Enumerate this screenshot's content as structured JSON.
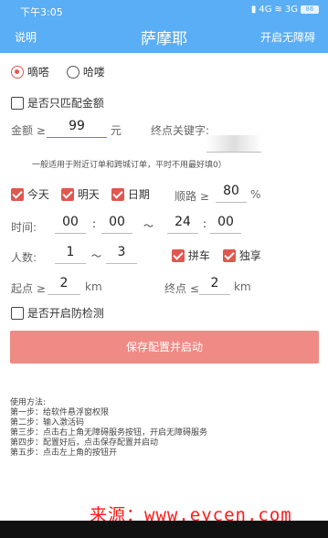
{
  "status": {
    "time": "下午3:05",
    "signal": "4G",
    "signal2": "3G",
    "battery": "86"
  },
  "appbar": {
    "left": "说明",
    "title": "萨摩耶",
    "right": "开启无障碍"
  },
  "mode": {
    "opt1": "嘀嗒",
    "opt2": "哈喽",
    "selected": "嘀嗒"
  },
  "match_amount_label": "是否只匹配金额",
  "amount": {
    "label": "金额 ≥",
    "value": "99",
    "unit": "元"
  },
  "keyword": {
    "label": "终点关键字:"
  },
  "hint": "一般适用于附近订单和跨城订单，平时不用最好填0）",
  "days": {
    "today": "今天",
    "tomorrow": "明天",
    "date": "日期"
  },
  "route": {
    "label": "顺路 ≥",
    "value": "80",
    "unit": "%"
  },
  "time": {
    "label": "时间:",
    "h1": "00",
    "m1": "00",
    "sep": ":",
    "tilde": "～",
    "h2": "24",
    "m2": "00"
  },
  "people": {
    "label": "人数:",
    "min": "1",
    "tilde": "～",
    "max": "3",
    "carpool": "拼车",
    "exclusive": "独享"
  },
  "start": {
    "label": "起点 ≥",
    "value": "2",
    "unit": "km"
  },
  "end": {
    "label": "终点 ≤",
    "value": "2",
    "unit": "km"
  },
  "detect_label": "是否开启防检测",
  "save_button": "保存配置并启动",
  "help": {
    "title": "使用方法:",
    "steps": [
      "第一步：给软件悬浮窗权限",
      "第二步：输入激活码",
      "第三步：点击右上角无障碍服务按钮，开启无障碍服务",
      "第四步：配置好后，点击保存配置并启动",
      "第五步：点击左上角的按钮开"
    ]
  },
  "watermark": "来源：www.eycen.com"
}
